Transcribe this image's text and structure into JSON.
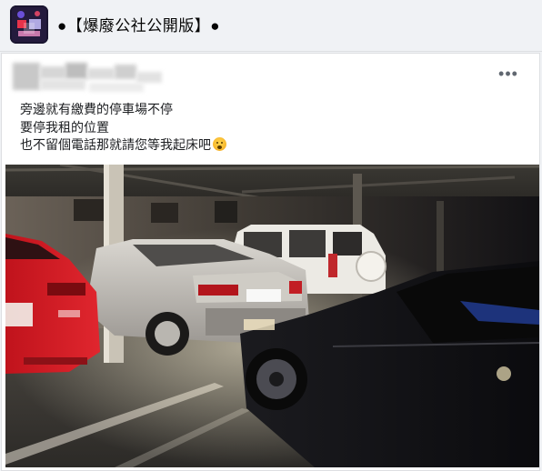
{
  "group": {
    "title": "●【爆廢公社公開版】●"
  },
  "post": {
    "author_name": "",
    "more_icon": "more-horizontal-icon",
    "text_lines": [
      "旁邊就有繳費的停車場不停",
      "要停我租的位置",
      "也不留個電話那就請您等我起床吧"
    ],
    "emoji": "yawning-face-emoji",
    "photo": {
      "subject": "parking garage at night with cars blocking a rented space"
    }
  },
  "colors": {
    "background": "#f0f2f5",
    "card": "#ffffff",
    "text": "#1c1e21"
  }
}
